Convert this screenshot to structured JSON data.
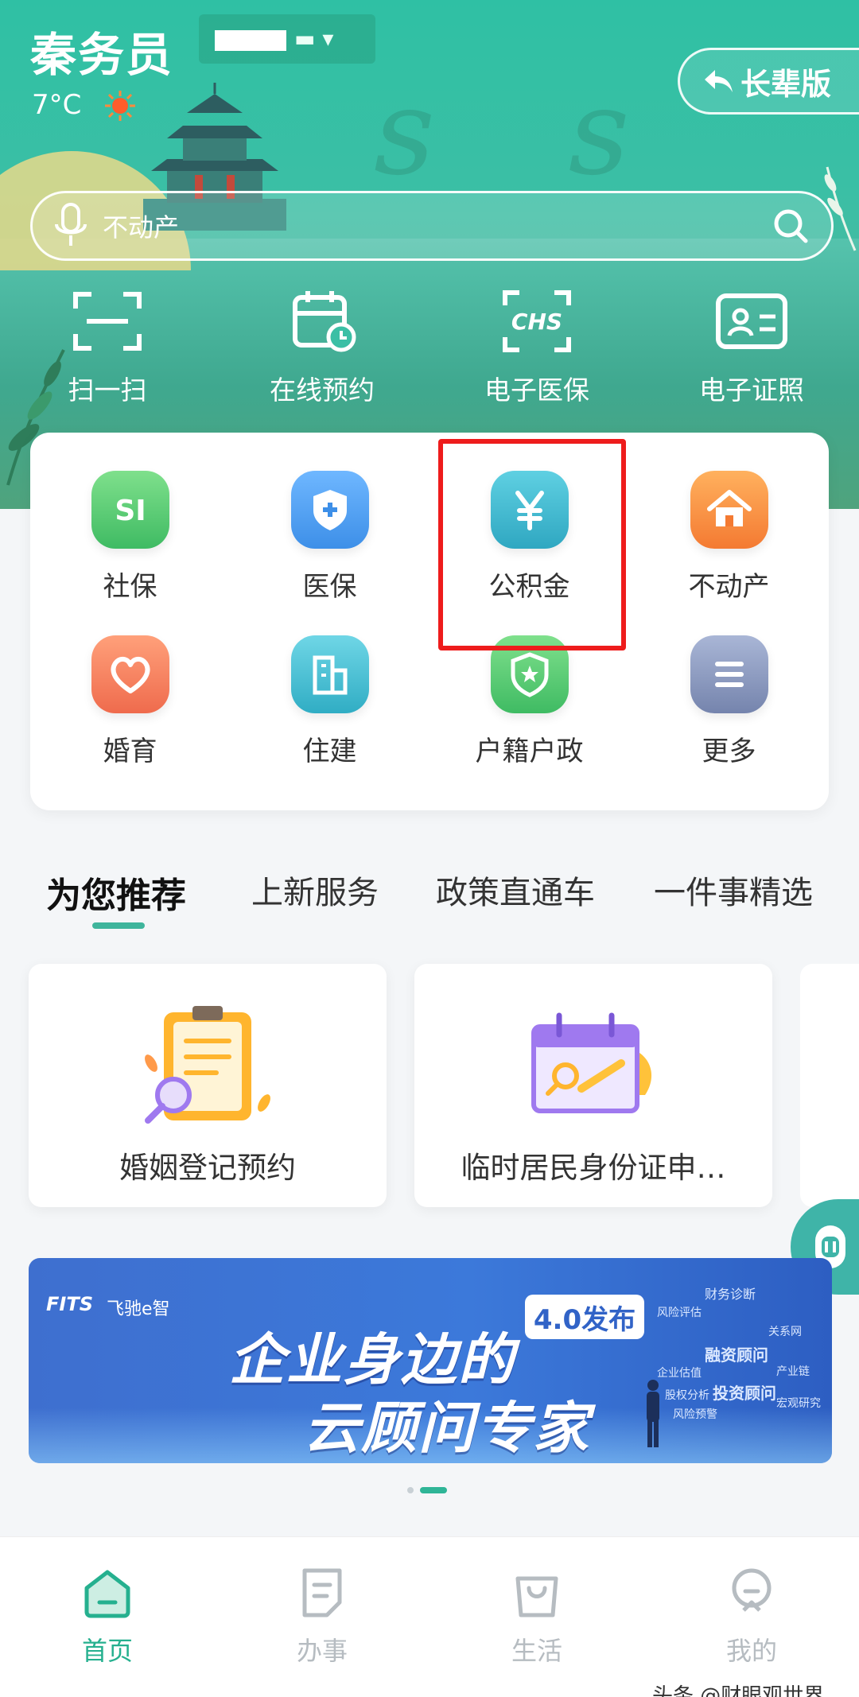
{
  "status": {
    "city": "秦务员",
    "region_suffix": "▬ ▾",
    "temperature": "7°C",
    "weather_icon": "sun-icon"
  },
  "header": {
    "elder_mode_label": "长辈版",
    "search_placeholder": "不动产"
  },
  "quick_actions": [
    {
      "label": "扫一扫",
      "icon": "scan-icon"
    },
    {
      "label": "在线预约",
      "icon": "calendar-clock-icon"
    },
    {
      "label": "电子医保",
      "icon": "chs-icon"
    },
    {
      "label": "电子证照",
      "icon": "id-card-icon"
    }
  ],
  "services": [
    {
      "label": "社保",
      "icon": "si-icon",
      "color": "#4cc46f"
    },
    {
      "label": "医保",
      "icon": "shield-plus-icon",
      "color": "#4a9df0"
    },
    {
      "label": "公积金",
      "icon": "yen-icon",
      "color": "#36b4cc"
    },
    {
      "label": "不动产",
      "icon": "house-icon",
      "color": "#f5853a"
    },
    {
      "label": "婚育",
      "icon": "heart-icon",
      "color": "#f07d5a"
    },
    {
      "label": "住建",
      "icon": "building-icon",
      "color": "#3db8c8"
    },
    {
      "label": "户籍户政",
      "icon": "police-shield-icon",
      "color": "#4cc46f"
    },
    {
      "label": "更多",
      "icon": "more-icon",
      "color": "#7f8eb5"
    }
  ],
  "tabs": [
    {
      "label": "为您推荐",
      "active": true
    },
    {
      "label": "上新服务",
      "active": false
    },
    {
      "label": "政策直通车",
      "active": false
    },
    {
      "label": "一件事精选",
      "active": false
    }
  ],
  "recommend_cards": [
    {
      "title": "婚姻登记预约",
      "icon": "clipboard-search-icon"
    },
    {
      "title": "临时居民身份证申…",
      "icon": "calendar-search-icon"
    }
  ],
  "banner": {
    "logo": "FITS",
    "logo_sub": "飞驰e智",
    "headline_1": "企业身边的",
    "headline_2": "云顾问专家",
    "badge": "4.0发布",
    "keywords": [
      "财务诊断",
      "风险评估",
      "融资顾问",
      "投资顾问",
      "企业估值",
      "产业链",
      "关系网",
      "股权分析",
      "风险预警",
      "宏观研究"
    ]
  },
  "carousel": {
    "page": 2,
    "total": 2
  },
  "bottom_nav": [
    {
      "label": "首页",
      "icon": "home-icon",
      "active": true
    },
    {
      "label": "办事",
      "icon": "document-icon",
      "active": false
    },
    {
      "label": "生活",
      "icon": "shopping-bag-icon",
      "active": false
    },
    {
      "label": "我的",
      "icon": "user-icon",
      "active": false
    }
  ],
  "watermark": "头条 @财眼观世界",
  "colors": {
    "brand_green": "#25b08f",
    "highlight_red": "#ee1c1c",
    "banner_blue": "#3c79da"
  }
}
